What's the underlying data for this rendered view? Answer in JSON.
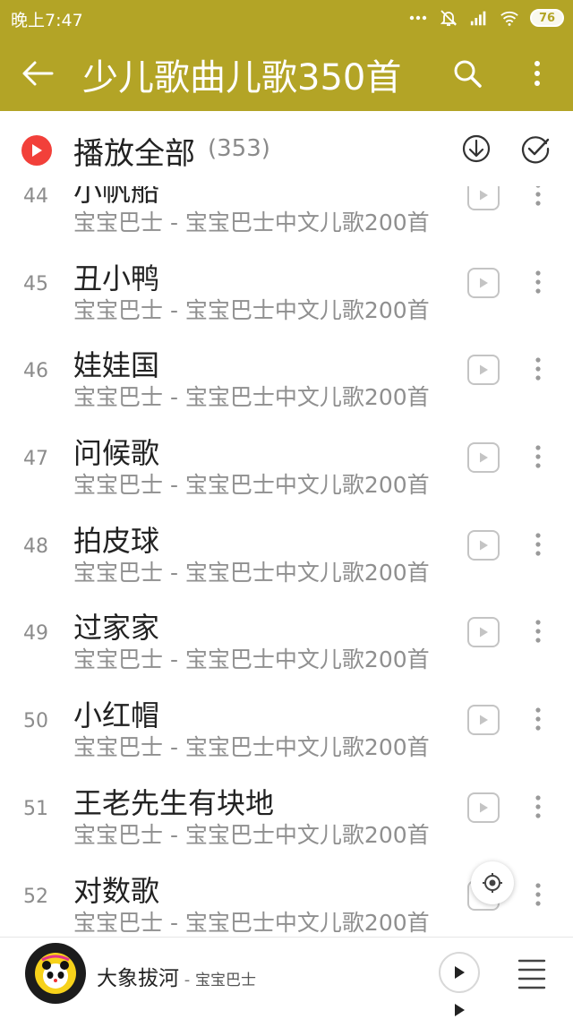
{
  "status_bar": {
    "time": "晚上7:47",
    "battery": "76",
    "icons": [
      "dots-icon",
      "mute-icon",
      "signal-icon",
      "wifi-icon",
      "battery-icon"
    ]
  },
  "app_bar": {
    "title": "少儿歌曲儿歌350首",
    "back_icon": "arrow-left-icon",
    "search_icon": "search-icon",
    "more_icon": "more-vertical-icon",
    "background_color": "#b3a426"
  },
  "play_all": {
    "label": "播放全部",
    "count": "(353)",
    "play_icon": "play-circle-icon",
    "download_icon": "download-icon",
    "multiselect_icon": "check-circle-icon",
    "accent_color": "#f2403a"
  },
  "songs": [
    {
      "index": "44",
      "title": "小帆船",
      "subtitle": "宝宝巴士 - 宝宝巴士中文儿歌200首"
    },
    {
      "index": "45",
      "title": "丑小鸭",
      "subtitle": "宝宝巴士 - 宝宝巴士中文儿歌200首"
    },
    {
      "index": "46",
      "title": "娃娃国",
      "subtitle": "宝宝巴士 - 宝宝巴士中文儿歌200首"
    },
    {
      "index": "47",
      "title": "问候歌",
      "subtitle": "宝宝巴士 - 宝宝巴士中文儿歌200首"
    },
    {
      "index": "48",
      "title": "拍皮球",
      "subtitle": "宝宝巴士 - 宝宝巴士中文儿歌200首"
    },
    {
      "index": "49",
      "title": "过家家",
      "subtitle": "宝宝巴士 - 宝宝巴士中文儿歌200首"
    },
    {
      "index": "50",
      "title": "小红帽",
      "subtitle": "宝宝巴士 - 宝宝巴士中文儿歌200首"
    },
    {
      "index": "51",
      "title": "王老先生有块地",
      "subtitle": "宝宝巴士 - 宝宝巴士中文儿歌200首"
    },
    {
      "index": "52",
      "title": "对数歌",
      "subtitle": "宝宝巴士 - 宝宝巴士中文儿歌200首"
    }
  ],
  "player": {
    "title": "大象拔河",
    "separator": " - ",
    "artist": "宝宝巴士"
  }
}
